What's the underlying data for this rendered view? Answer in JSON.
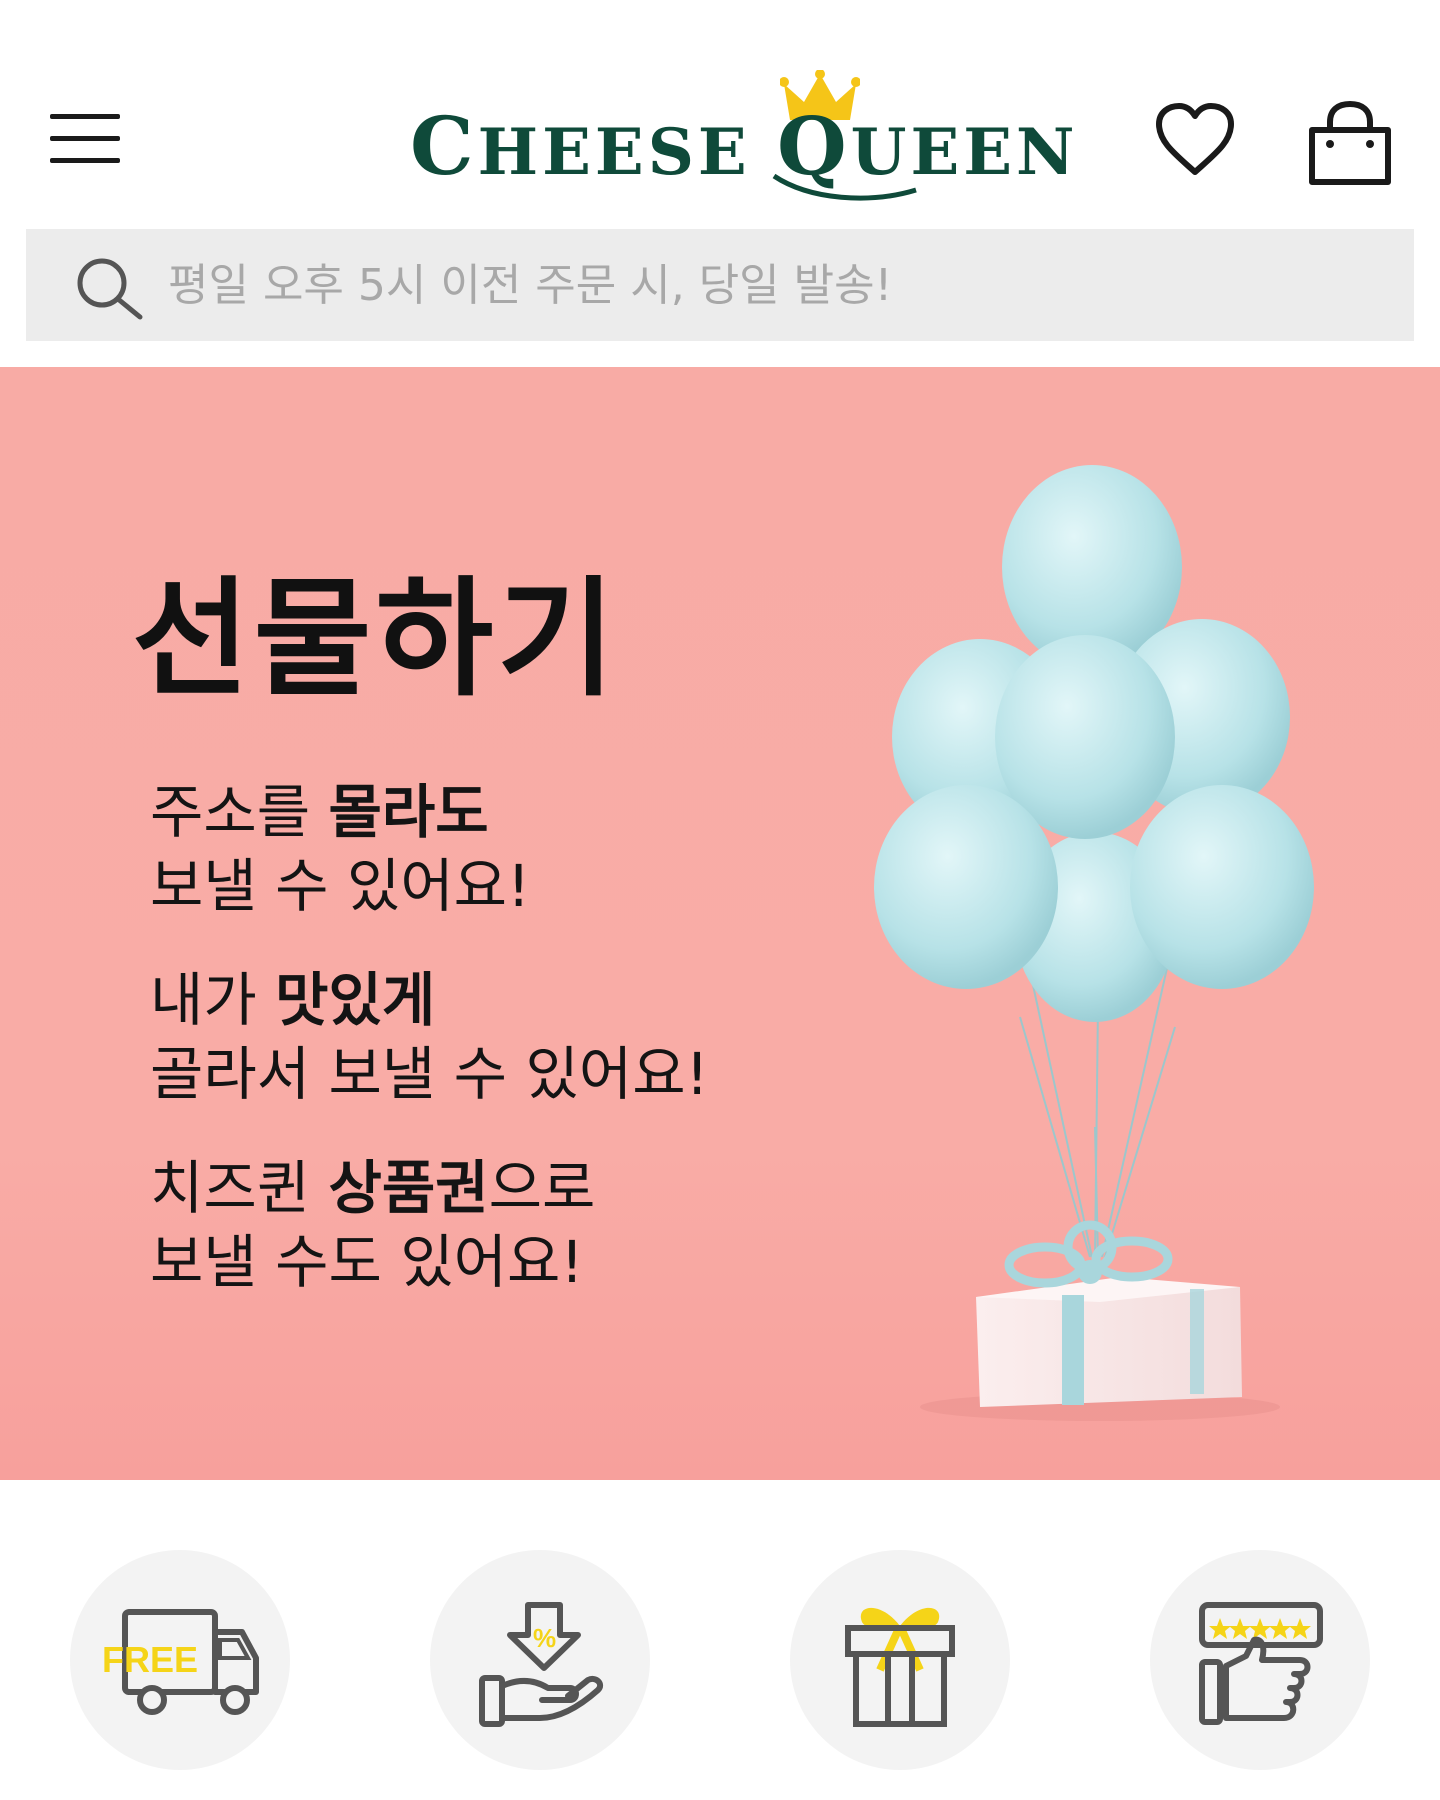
{
  "header": {
    "logo_text_1": "C",
    "logo_text_2": "HEESE ",
    "logo_text_3": "Q",
    "logo_text_4": "UEEN",
    "brand_color": "#0f4a3a",
    "crown_color": "#f5c518"
  },
  "search": {
    "placeholder": "평일 오후 5시 이전 주문 시, 당일 발송!"
  },
  "banner": {
    "title": "선물하기",
    "background": "#f9aca6",
    "groups": [
      {
        "line1_normal": "주소를 ",
        "line1_bold": "몰라도",
        "line1_after": "",
        "line2": "보낼 수 있어요!"
      },
      {
        "line1_normal": "내가 ",
        "line1_bold": "맛있게",
        "line1_after": "",
        "line2": "골라서 보낼 수 있어요!"
      },
      {
        "line1_normal": "치즈퀸 ",
        "line1_bold": "상품권",
        "line1_after": "으로",
        "line2": "보낼 수도 있어요!"
      }
    ]
  },
  "features": [
    {
      "icon": "free-delivery-truck-icon",
      "label": "FREE"
    },
    {
      "icon": "discount-hand-icon",
      "label": "%"
    },
    {
      "icon": "gift-box-icon"
    },
    {
      "icon": "review-thumbs-up-icon"
    }
  ],
  "colors": {
    "accent_yellow": "#f5d418",
    "icon_gray": "#555555",
    "balloon": "#bfe6ea"
  }
}
